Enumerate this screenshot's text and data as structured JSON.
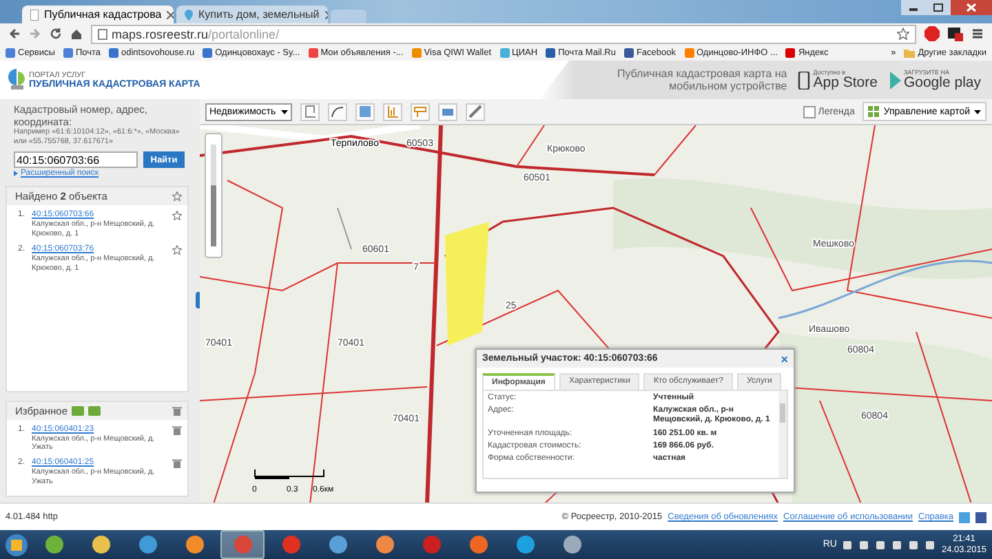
{
  "browser": {
    "tabs": [
      {
        "title": "Публичная кадастрова",
        "selected": true
      },
      {
        "title": "Купить дом, земельный",
        "selected": false
      }
    ],
    "url_host": "maps.rosreestr.ru",
    "url_path": "/portalonline/",
    "bookmarks": [
      "Сервисы",
      "Почта",
      "odintsovohouse.ru",
      "Одинцовохаус - Sy...",
      "Мои объявления -...",
      "Visa QIWI Wallet",
      "ЦИАН",
      "Почта Mail.Ru",
      "Facebook",
      "Одинцово-ИНФО ...",
      "Яндекс"
    ],
    "more": "»",
    "other_bookmarks": "Другие закладки"
  },
  "header": {
    "portal": "ПОРТАЛ УСЛУГ",
    "title": "ПУБЛИЧНАЯ КАДАСТРОВАЯ КАРТА",
    "promo": "Публичная кадастровая карта на мобильном устройстве",
    "stores": [
      {
        "kind": "apple",
        "caption": "Доступно в",
        "name": "App Store"
      },
      {
        "kind": "google",
        "caption": "ЗАГРУЗИТЕ НА",
        "name": "Google play"
      }
    ]
  },
  "search": {
    "label": "Кадастровый номер, адрес, координата:",
    "hint": "Например «61:6:10104:12», «61:6:*», «Москва» или «55.755768, 37.617671»",
    "value": "40:15:060703:66",
    "button": "Найти",
    "advanced": "Расширенный поиск"
  },
  "results": {
    "title": "Найдено **2** объекта",
    "items": [
      {
        "number": "1.",
        "id": "40:15:060703:66",
        "address": "Калужская обл., р-н Мещовский, д. Крюково, д. 1"
      },
      {
        "number": "2.",
        "id": "40:15:060703:76",
        "address": "Калужская обл., р-н Мещовский, д. Крюково, д. 1"
      }
    ]
  },
  "favorites": {
    "title": "Избранное",
    "items": [
      {
        "number": "1.",
        "id": "40:15:060401:23",
        "address": "Калужская обл., р-н Мещовский, д. Ужать"
      },
      {
        "number": "2.",
        "id": "40:15:060401:25",
        "address": "Калужская обл., р-н Мещовский, д. Ужать"
      }
    ]
  },
  "toolbar": {
    "layer": "Недвижимость",
    "legend": {
      "label": "Легенда",
      "checked": false
    },
    "map_control": "Управление картой"
  },
  "map": {
    "zoom": {
      "level": 0.6
    },
    "labels": [
      "Терпилово",
      "60503",
      "Крюково",
      "60501",
      "60601",
      "70401",
      "70401",
      "70401",
      "Мешково",
      "Ивашово",
      "60804",
      "60804",
      "25",
      "7"
    ],
    "scale": [
      "0",
      "0.3",
      "0.6км"
    ]
  },
  "popup": {
    "title": "Земельный участок: 40:15:060703:66",
    "close": "×",
    "tabs": [
      {
        "label": "Информация",
        "selected": true
      },
      {
        "label": "Характеристики",
        "selected": false
      },
      {
        "label": "Кто обслуживает?",
        "selected": false
      },
      {
        "label": "Услуги",
        "selected": false
      }
    ],
    "rows": [
      {
        "label": "Статус:",
        "value": "Учтенный"
      },
      {
        "label": "Адрес:",
        "value": "Калужская обл., р-н Мещовский, д. Крюково, д. 1"
      },
      {
        "label": "Уточненная площадь:",
        "value": "160 251.00 кв. м"
      },
      {
        "label": "Кадастровая стоимость:",
        "value": "169 866.06 руб."
      },
      {
        "label": "Форма собственности:",
        "value": "частная"
      }
    ]
  },
  "footer": {
    "version": "4.01.484 http",
    "copyright": "© Росреестр, 2010-2015",
    "links": [
      "Сведения об обновлениях",
      "Соглашение об использовании",
      "Справка"
    ]
  },
  "taskbar": {
    "apps": [
      {
        "kind": "torrent",
        "selected": false
      },
      {
        "kind": "folder",
        "selected": false
      },
      {
        "kind": "ie",
        "selected": false
      },
      {
        "kind": "player",
        "selected": false
      },
      {
        "kind": "chrome",
        "selected": true
      },
      {
        "kind": "yandex",
        "selected": false
      },
      {
        "kind": "audio",
        "selected": false
      },
      {
        "kind": "grid",
        "selected": false
      },
      {
        "kind": "opera",
        "selected": false
      },
      {
        "kind": "ybrowser",
        "selected": false
      },
      {
        "kind": "skype",
        "selected": false
      },
      {
        "kind": "paint",
        "selected": false
      }
    ],
    "language": "RU",
    "time": "21:41",
    "date": "24.03.2015"
  }
}
